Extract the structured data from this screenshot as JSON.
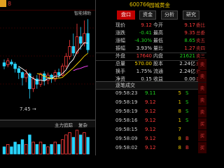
{
  "chart": {
    "top_label": "8",
    "smart_label": "智能辅助",
    "low_label": "7.45",
    "low_arrow": "→",
    "bottom_bar": {
      "label": "主力追踪",
      "reset": "复杂"
    },
    "candles": [
      {
        "o": 8.95,
        "c": 8.9,
        "h": 9.0,
        "l": 8.85
      },
      {
        "o": 8.92,
        "c": 8.98,
        "h": 9.02,
        "l": 8.88
      },
      {
        "o": 8.96,
        "c": 8.93,
        "h": 9.0,
        "l": 8.9
      },
      {
        "o": 8.93,
        "c": 8.86,
        "h": 8.96,
        "l": 8.8
      },
      {
        "o": 8.86,
        "c": 8.8,
        "h": 8.9,
        "l": 8.7
      },
      {
        "o": 8.8,
        "c": 8.72,
        "h": 8.82,
        "l": 8.6
      },
      {
        "o": 8.72,
        "c": 8.78,
        "h": 8.85,
        "l": 8.65
      },
      {
        "o": 8.78,
        "c": 8.55,
        "h": 8.8,
        "l": 8.4
      },
      {
        "o": 8.55,
        "c": 8.7,
        "h": 8.74,
        "l": 8.5
      },
      {
        "o": 8.7,
        "c": 8.62,
        "h": 8.76,
        "l": 8.55
      },
      {
        "o": 8.62,
        "c": 8.78,
        "h": 8.8,
        "l": 8.58
      },
      {
        "o": 8.78,
        "c": 8.68,
        "h": 8.82,
        "l": 8.6
      },
      {
        "o": 8.68,
        "c": 8.76,
        "h": 8.8,
        "l": 8.62
      },
      {
        "o": 8.76,
        "c": 8.7,
        "h": 8.78,
        "l": 8.64
      },
      {
        "o": 8.7,
        "c": 8.8,
        "h": 8.84,
        "l": 8.66
      },
      {
        "o": 8.8,
        "c": 8.76,
        "h": 8.86,
        "l": 8.72
      },
      {
        "o": 8.76,
        "c": 8.9,
        "h": 8.94,
        "l": 8.74
      },
      {
        "o": 8.9,
        "c": 9.05,
        "h": 9.1,
        "l": 8.86
      },
      {
        "o": 9.05,
        "c": 9.2,
        "h": 9.3,
        "l": 9.0
      },
      {
        "o": 9.2,
        "c": 9.1,
        "h": 9.4,
        "l": 9.05
      },
      {
        "o": 9.1,
        "c": 9.35,
        "h": 9.55,
        "l": 9.08
      },
      {
        "o": 9.35,
        "c": 9.25,
        "h": 9.5,
        "l": 9.15
      },
      {
        "o": 9.25,
        "c": 9.4,
        "h": 9.6,
        "l": 9.2
      },
      {
        "o": 9.4,
        "c": 9.15,
        "h": 9.62,
        "l": 9.1
      }
    ],
    "volumes": [
      3,
      4,
      3,
      5,
      4,
      6,
      4,
      8,
      5,
      4,
      5,
      4,
      3,
      4,
      5,
      4,
      6,
      8,
      9,
      7,
      10,
      8,
      9,
      7
    ]
  },
  "panel": {
    "code": "600766",
    "name": "园城黄金",
    "tabs": [
      "盘口",
      "资金",
      "分析",
      "研究"
    ],
    "quote_rows": [
      {
        "k1": "现价",
        "v1": "9.12",
        "c1": "red",
        "k2": "今开",
        "v2": "9.17",
        "c2": "red",
        "side": "委比"
      },
      {
        "k1": "涨跌",
        "v1": "-0.41",
        "c1": "green",
        "k2": "最高",
        "v2": "9.35",
        "c2": "red",
        "side": "总委"
      },
      {
        "k1": "涨幅",
        "v1": "-4.30%",
        "c1": "green",
        "k2": "最低",
        "v2": "8.65",
        "c2": "green",
        "side": "卖五"
      },
      {
        "k1": "振幅",
        "v1": "3.93%",
        "c1": "white",
        "k2": "量比",
        "v2": "1.27",
        "c2": "red",
        "side": "卖四"
      },
      {
        "k1": "外盘",
        "v1": "17640",
        "c1": "red",
        "k2": "内盘",
        "v2": "21621",
        "c2": "green",
        "side": "卖三"
      },
      {
        "k1": "总量",
        "v1": "570.00",
        "c1": "yellow",
        "k2": "股本",
        "v2": "2.24亿",
        "c2": "white",
        "side": "卖二"
      },
      {
        "k1": "换手",
        "v1": "1.75%",
        "c1": "white",
        "k2": "流通",
        "v2": "2.24亿",
        "c2": "white",
        "side": "卖一"
      },
      {
        "k1": "净资",
        "v1": "0.15",
        "c1": "white",
        "k2": "收益",
        "v2": "0.00",
        "c2": "white",
        "side": "买一"
      }
    ],
    "trades_header": "逐笔成交",
    "trades_header_right": "9",
    "trades": [
      {
        "t": "09:58:23",
        "p": "9.11",
        "q": "5",
        "s": "S",
        "pc": "green",
        "sc": "green"
      },
      {
        "t": "09:58:19",
        "p": "9.12",
        "q": "1",
        "s": "S",
        "pc": "red",
        "sc": "green"
      },
      {
        "t": "09:58:19",
        "p": "9.12",
        "q": "8",
        "s": "S",
        "pc": "red",
        "sc": "green"
      },
      {
        "t": "09:58:16",
        "p": "9.12",
        "q": "1",
        "s": "S",
        "pc": "red",
        "sc": "green"
      },
      {
        "t": "09:58:15",
        "p": "9.12",
        "q": "7",
        "s": "",
        "pc": "red",
        "sc": "green"
      },
      {
        "t": "09:58:09",
        "p": "9.12",
        "q": "8",
        "s": "B",
        "pc": "red",
        "sc": "red"
      },
      {
        "t": "09:58:02",
        "p": "9.12",
        "q": "8",
        "s": "B",
        "pc": "red",
        "sc": "red"
      }
    ],
    "right_strip": [
      "卖",
      "卖",
      "卖",
      "卖",
      "卖",
      "买",
      "买",
      "买"
    ]
  }
}
